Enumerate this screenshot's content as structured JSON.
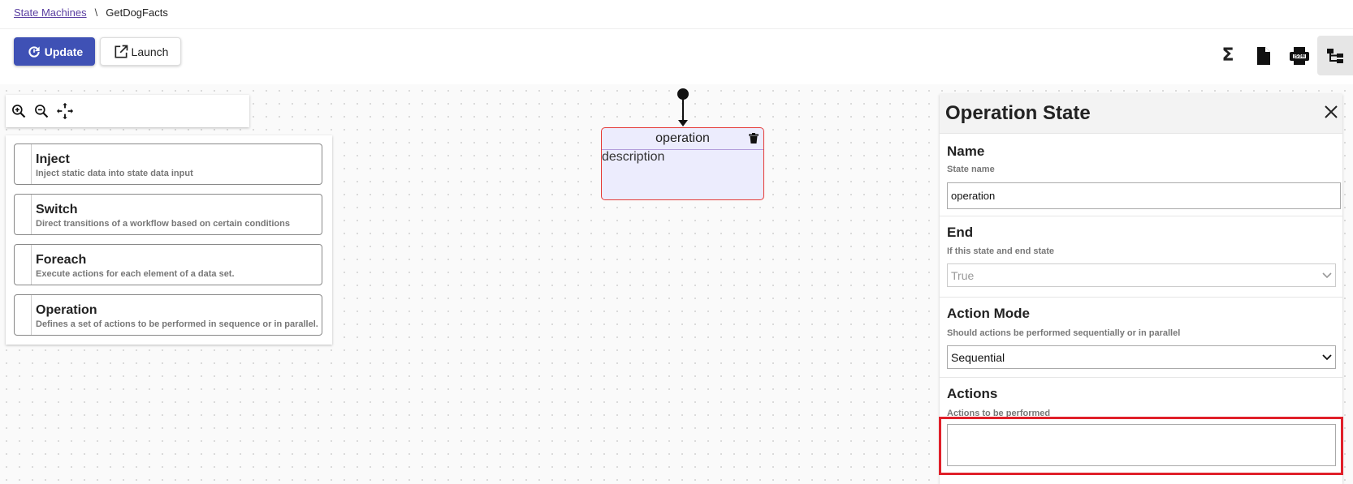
{
  "breadcrumb": {
    "root": "State Machines",
    "separator": "\\",
    "current": "GetDogFacts"
  },
  "toolbar": {
    "update_label": "Update",
    "launch_label": "Launch",
    "sigma": "Σ",
    "right_icons": [
      "sigma-icon",
      "file-icon",
      "print-icon",
      "json-icon",
      "tree-icon"
    ]
  },
  "palette": {
    "items": [
      {
        "title": "Inject",
        "desc": "Inject static data into state data input"
      },
      {
        "title": "Switch",
        "desc": "Direct transitions of a workflow based on certain conditions"
      },
      {
        "title": "Foreach",
        "desc": "Execute actions for each element of a data set."
      },
      {
        "title": "Operation",
        "desc": "Defines a set of actions to be performed in sequence or in parallel."
      }
    ]
  },
  "node": {
    "name": "operation",
    "description": "description"
  },
  "panel": {
    "title": "Operation State",
    "name": {
      "label": "Name",
      "hint": "State name",
      "value": "operation"
    },
    "end": {
      "label": "End",
      "hint": "If this state and end state",
      "value": "True"
    },
    "action_mode": {
      "label": "Action Mode",
      "hint": "Should actions be performed sequentially or in parallel",
      "value": "Sequential"
    },
    "actions": {
      "label": "Actions",
      "hint": "Actions to be performed",
      "value": ""
    }
  },
  "colors": {
    "primary": "#3f51b5",
    "highlight": "#e0202a",
    "node_fill": "#ececfd",
    "node_border": "#e53935",
    "link": "#5a3ea1"
  }
}
